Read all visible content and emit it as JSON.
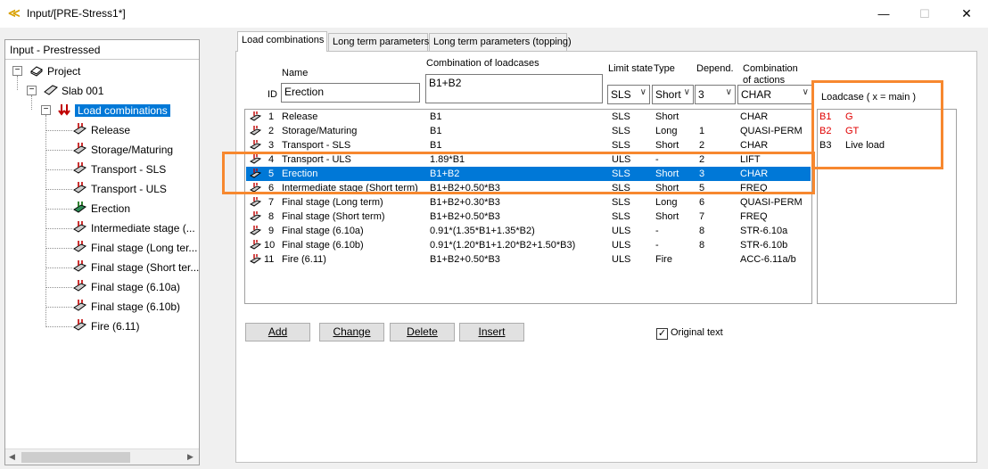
{
  "window": {
    "title": "Input/[PRE-Stress1*]",
    "min_glyph": "—",
    "max_glyph": "☐",
    "close_glyph": "✕"
  },
  "tree": {
    "header": "Input - Prestressed",
    "project": "Project",
    "slab": "Slab 001",
    "group": "Load combinations",
    "items": [
      "Release",
      "Storage/Maturing",
      "Transport - SLS",
      "Transport - ULS",
      "Erection",
      "Intermediate stage (...",
      "Final stage (Long ter...",
      "Final stage (Short ter...",
      "Final stage (6.10a)",
      "Final stage (6.10b)",
      "Fire (6.11)"
    ],
    "scroll_left": "◀",
    "scroll_right": "▶"
  },
  "tabs": [
    "Load combinations",
    "Long term parameters",
    "Long term parameters (topping)"
  ],
  "form": {
    "id_label": "ID",
    "name_label": "Name",
    "name_value": "Erection",
    "combo_label": "Combination of loadcases",
    "combo_value": "B1+B2",
    "limit_label": "Limit state",
    "limit_value": "SLS",
    "type_label": "Type",
    "type_value": "Short",
    "depend_label": "Depend.",
    "depend_value": "3",
    "coa_label_1": "Combination",
    "coa_label_2": "of actions",
    "coa_value": "CHAR",
    "chevron": "∨"
  },
  "rows": [
    {
      "id": "1",
      "name": "Release",
      "combo": "B1",
      "limit": "SLS",
      "type": "Short",
      "dep": "",
      "coa": "CHAR"
    },
    {
      "id": "2",
      "name": "Storage/Maturing",
      "combo": "B1",
      "limit": "SLS",
      "type": "Long",
      "dep": "1",
      "coa": "QUASI-PERM"
    },
    {
      "id": "3",
      "name": "Transport - SLS",
      "combo": "B1",
      "limit": "SLS",
      "type": "Short",
      "dep": "2",
      "coa": "CHAR"
    },
    {
      "id": "4",
      "name": "Transport - ULS",
      "combo": "1.89*B1",
      "limit": "ULS",
      "type": "-",
      "dep": "2",
      "coa": "LIFT"
    },
    {
      "id": "5",
      "name": "Erection",
      "combo": "B1+B2",
      "limit": "SLS",
      "type": "Short",
      "dep": "3",
      "coa": "CHAR"
    },
    {
      "id": "6",
      "name": "Intermediate stage (Short term)",
      "combo": "B1+B2+0.50*B3",
      "limit": "SLS",
      "type": "Short",
      "dep": "5",
      "coa": "FREQ"
    },
    {
      "id": "7",
      "name": "Final stage (Long term)",
      "combo": "B1+B2+0.30*B3",
      "limit": "SLS",
      "type": "Long",
      "dep": "6",
      "coa": "QUASI-PERM"
    },
    {
      "id": "8",
      "name": "Final stage (Short term)",
      "combo": "B1+B2+0.50*B3",
      "limit": "SLS",
      "type": "Short",
      "dep": "7",
      "coa": "FREQ"
    },
    {
      "id": "9",
      "name": "Final stage (6.10a)",
      "combo": "0.91*(1.35*B1+1.35*B2)",
      "limit": "ULS",
      "type": "-",
      "dep": "8",
      "coa": "STR-6.10a"
    },
    {
      "id": "10",
      "name": "Final stage (6.10b)",
      "combo": "0.91*(1.20*B1+1.20*B2+1.50*B3)",
      "limit": "ULS",
      "type": "-",
      "dep": "8",
      "coa": "STR-6.10b"
    },
    {
      "id": "11",
      "name": "Fire (6.11)",
      "combo": "B1+B2+0.50*B3",
      "limit": "ULS",
      "type": "Fire",
      "dep": "",
      "coa": "ACC-6.11a/b"
    }
  ],
  "loadcases": {
    "header": "Loadcase ( x = main )",
    "items": [
      {
        "id": "B1",
        "name": "G"
      },
      {
        "id": "B2",
        "name": "GT"
      },
      {
        "id": "B3",
        "name": "Live load"
      }
    ]
  },
  "buttons": {
    "add": "Add",
    "change": "Change",
    "delete": "Delete",
    "insert": "Insert"
  },
  "original_text": {
    "label": "Original text",
    "checked": true,
    "check_glyph": "✓"
  },
  "colors": {
    "selection": "#0078d7",
    "highlight": "#f7882f",
    "main_loadcase": "#e00000"
  }
}
